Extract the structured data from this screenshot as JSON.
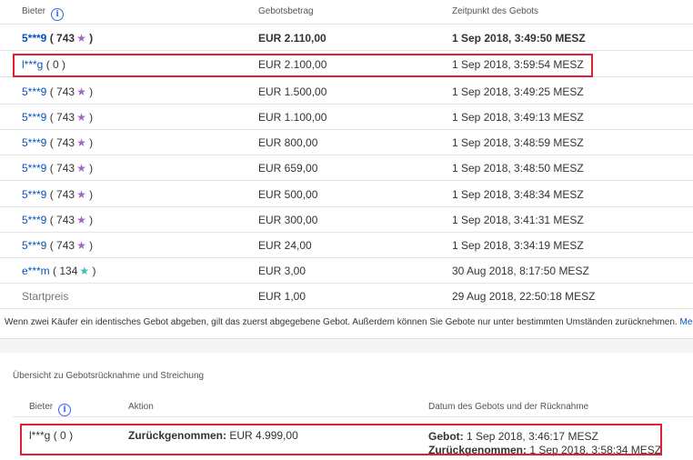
{
  "bid_table": {
    "headers": {
      "bidder": "Bieter",
      "amount": "Gebotsbetrag",
      "time": "Zeitpunkt des Gebots"
    },
    "info_glyph": "i",
    "rows": [
      {
        "bidder": "5***9",
        "score": "743",
        "star": "★",
        "star_color": "#a066c8",
        "amount": "EUR 2.110,00",
        "time": "1 Sep 2018, 3:49:50 MESZ",
        "winning": true
      },
      {
        "bidder": "l***g",
        "score": "0",
        "star": "",
        "star_color": "",
        "amount": "EUR 2.100,00",
        "time": "1 Sep 2018, 3:59:54 MESZ",
        "highlighted": true
      },
      {
        "bidder": "5***9",
        "score": "743",
        "star": "★",
        "star_color": "#a066c8",
        "amount": "EUR 1.500,00",
        "time": "1 Sep 2018, 3:49:25 MESZ"
      },
      {
        "bidder": "5***9",
        "score": "743",
        "star": "★",
        "star_color": "#a066c8",
        "amount": "EUR 1.100,00",
        "time": "1 Sep 2018, 3:49:13 MESZ"
      },
      {
        "bidder": "5***9",
        "score": "743",
        "star": "★",
        "star_color": "#a066c8",
        "amount": "EUR 800,00",
        "time": "1 Sep 2018, 3:48:59 MESZ"
      },
      {
        "bidder": "5***9",
        "score": "743",
        "star": "★",
        "star_color": "#a066c8",
        "amount": "EUR 659,00",
        "time": "1 Sep 2018, 3:48:50 MESZ"
      },
      {
        "bidder": "5***9",
        "score": "743",
        "star": "★",
        "star_color": "#a066c8",
        "amount": "EUR 500,00",
        "time": "1 Sep 2018, 3:48:34 MESZ"
      },
      {
        "bidder": "5***9",
        "score": "743",
        "star": "★",
        "star_color": "#a066c8",
        "amount": "EUR 300,00",
        "time": "1 Sep 2018, 3:41:31 MESZ"
      },
      {
        "bidder": "5***9",
        "score": "743",
        "star": "★",
        "star_color": "#a066c8",
        "amount": "EUR 24,00",
        "time": "1 Sep 2018, 3:34:19 MESZ"
      },
      {
        "bidder": "e***m",
        "score": "134",
        "star": "★",
        "star_color": "#39c0b8",
        "amount": "EUR 3,00",
        "time": "30 Aug 2018, 8:17:50 MESZ"
      }
    ],
    "start_row": {
      "label": "Startpreis",
      "amount": "EUR 1,00",
      "time": "29 Aug 2018, 22:50:18 MESZ"
    }
  },
  "note": {
    "text": "Wenn zwei Käufer ein identisches Gebot abgeben, gilt das zuerst abgegebene Gebot. Außerdem können Sie Gebote nur unter bestimmten Umständen zurücknehmen.",
    "link": "Mehr"
  },
  "retraction": {
    "title": "Übersicht zu Gebotsrücknahme und Streichung",
    "headers": {
      "bidder": "Bieter",
      "action": "Aktion",
      "dates": "Datum des Gebots und der Rücknahme"
    },
    "row": {
      "bidder": "l***g",
      "score": "0",
      "action_label": "Zurückgenommen:",
      "action_amount": "EUR 4.999,00",
      "bid_label": "Gebot:",
      "bid_time": "1 Sep 2018, 3:46:17 MESZ",
      "retracted_label": "Zurückgenommen:",
      "retracted_time": "1 Sep 2018, 3:58:34 MESZ"
    }
  },
  "colors": {
    "link": "#0654ba",
    "highlight_box": "#e0212f",
    "info_icon": "#3665f3"
  }
}
